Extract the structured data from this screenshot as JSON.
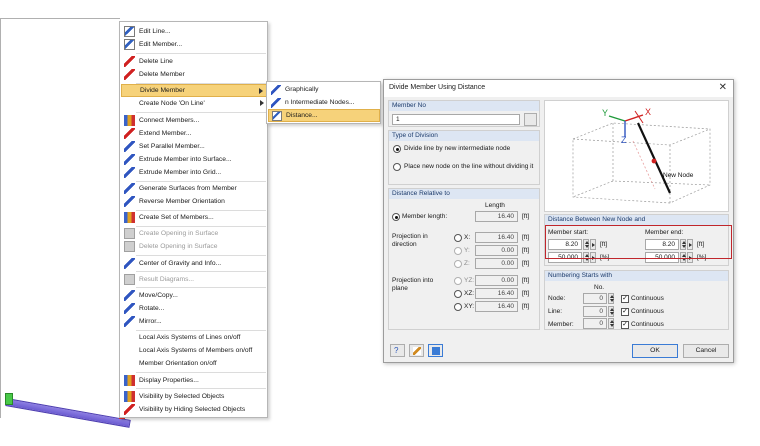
{
  "menu": {
    "items": [
      {
        "label": "Edit Line...",
        "icon": "edit-line-icon"
      },
      {
        "label": "Edit Member...",
        "icon": "edit-member-icon"
      },
      {
        "label": "Delete Line",
        "icon": "delete-line-icon"
      },
      {
        "label": "Delete Member",
        "icon": "delete-member-icon"
      },
      {
        "label": "Divide Member",
        "icon": "divide-member-icon"
      },
      {
        "label": "Create Node 'On Line'",
        "icon": "create-node-icon"
      },
      {
        "label": "Connect Members...",
        "icon": "connect-members-icon"
      },
      {
        "label": "Extend Member...",
        "icon": "extend-member-icon"
      },
      {
        "label": "Set Parallel Member...",
        "icon": "parallel-member-icon"
      },
      {
        "label": "Extrude Member into Surface...",
        "icon": "extrude-surface-icon"
      },
      {
        "label": "Extrude Member into Grid...",
        "icon": "extrude-grid-icon"
      },
      {
        "label": "Generate Surfaces from Member",
        "icon": "generate-surfaces-icon"
      },
      {
        "label": "Reverse Member Orientation",
        "icon": "reverse-orientation-icon"
      },
      {
        "label": "Create Set of Members...",
        "icon": "set-of-members-icon"
      },
      {
        "label": "Create Opening in Surface",
        "icon": "create-opening-icon"
      },
      {
        "label": "Delete Opening in Surface",
        "icon": "delete-opening-icon"
      },
      {
        "label": "Center of Gravity and Info...",
        "icon": "center-gravity-icon"
      },
      {
        "label": "Result Diagrams...",
        "icon": "result-diagrams-icon"
      },
      {
        "label": "Move/Copy...",
        "icon": "move-copy-icon"
      },
      {
        "label": "Rotate...",
        "icon": "rotate-icon"
      },
      {
        "label": "Mirror...",
        "icon": "mirror-icon"
      },
      {
        "label": "Local Axis Systems of Lines on/off",
        "icon": ""
      },
      {
        "label": "Local Axis Systems of Members on/off",
        "icon": ""
      },
      {
        "label": "Member Orientation on/off",
        "icon": ""
      },
      {
        "label": "Display Properties...",
        "icon": "display-properties-icon"
      },
      {
        "label": "Visibility by Selected Objects",
        "icon": "visibility-selected-icon"
      },
      {
        "label": "Visibility by Hiding Selected Objects",
        "icon": "visibility-hiding-icon"
      }
    ]
  },
  "submenu": {
    "items": [
      {
        "label": "Graphically",
        "icon": "graphically-icon"
      },
      {
        "label": "n Intermediate Nodes...",
        "icon": "intermediate-nodes-icon"
      },
      {
        "label": "Distance...",
        "icon": "distance-icon"
      }
    ]
  },
  "dialog": {
    "title": "Divide Member Using Distance",
    "member_no": {
      "header": "Member No",
      "value": "1"
    },
    "type_of_division": {
      "header": "Type of Division",
      "option1": "Divide line by new intermediate node",
      "option2": "Place new node on the line without dividing it"
    },
    "distance_relative": {
      "header": "Distance Relative to",
      "length_col": "Length",
      "member_length_label": "Member length:",
      "member_length_value": "16.40",
      "unit": "[ft]",
      "projection_direction_label": "Projection in direction",
      "x_label": "X:",
      "x_value": "16.40",
      "y_label": "Y:",
      "y_value": "0.00",
      "z_label": "Z:",
      "z_value": "0.00",
      "projection_plane_label": "Projection into plane",
      "yz_label": "YZ:",
      "yz_value": "0.00",
      "xz_label": "XZ:",
      "xz_value": "16.40",
      "xy_label": "XY:",
      "xy_value": "16.40"
    },
    "diagram": {
      "x": "X",
      "y": "Y",
      "z": "Z",
      "new_node": "New Node"
    },
    "distance_between": {
      "header": "Distance Between New Node and",
      "start_label": "Member start:",
      "end_label": "Member end:",
      "start_value": "8.20",
      "end_value": "8.20",
      "start_pct": "50.000",
      "end_pct": "50.000",
      "unit_ft": "[ft]",
      "unit_pct": "[%]"
    },
    "numbering": {
      "header": "Numbering Starts with",
      "no_col": "No.",
      "node_label": "Node:",
      "node_value": "0",
      "line_label": "Line:",
      "line_value": "0",
      "member_label": "Member:",
      "member_value": "0",
      "continuous": "Continuous"
    },
    "ok": "OK",
    "cancel": "Cancel"
  }
}
